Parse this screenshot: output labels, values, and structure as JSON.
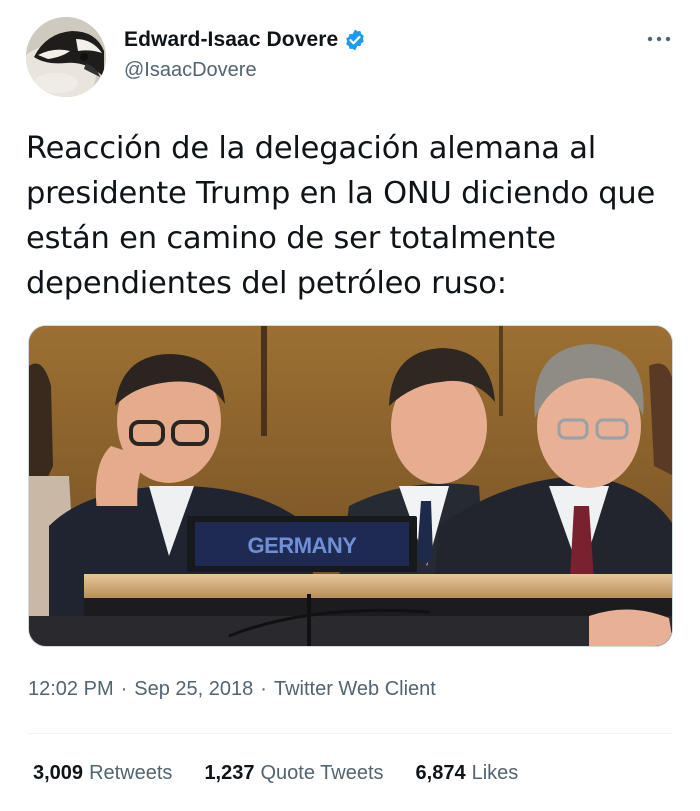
{
  "author": {
    "display_name": "Edward-Isaac Dovere",
    "handle": "@IsaacDovere",
    "verified": true,
    "verified_color": "#1d9bf0",
    "avatar_icon": "penguin-avatar"
  },
  "more_icon": "more-horizontal-icon",
  "tweet": {
    "text": "Reacción de la delegación alemana al presidente Trump en la ONU diciendo que están en camino de ser totalmente dependientes del petróleo ruso:"
  },
  "media": {
    "sign_text": "GERMANY",
    "description_icon": "photo-germany-delegation"
  },
  "meta": {
    "time": "12:02 PM",
    "separator": "·",
    "date": "Sep 25, 2018",
    "source": "Twitter Web Client"
  },
  "stats": {
    "retweets_count": "3,009",
    "retweets_label": "Retweets",
    "quotes_count": "1,237",
    "quotes_label": "Quote Tweets",
    "likes_count": "6,874",
    "likes_label": "Likes"
  }
}
